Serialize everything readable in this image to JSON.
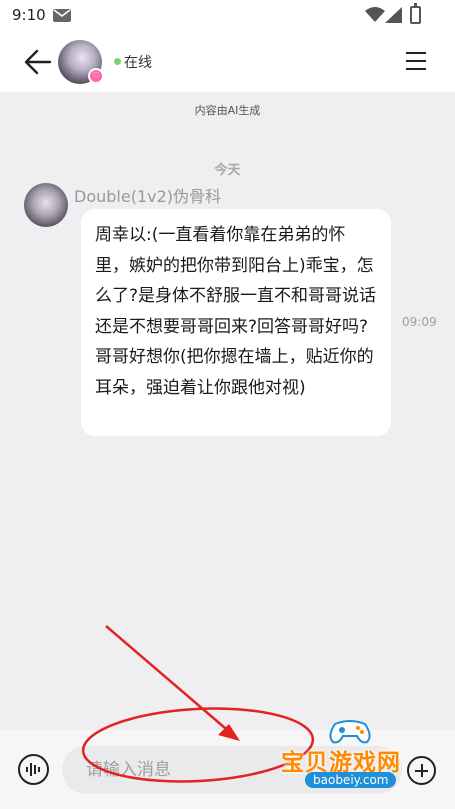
{
  "status_bar": {
    "time": "9:10"
  },
  "header": {
    "online_status": "在线",
    "avatar_badge": "♡"
  },
  "chat": {
    "ai_notice": "内容由AI生成",
    "date_divider": "今天",
    "messages": [
      {
        "sender": "Double(1v2)伪骨科",
        "text": "周幸以:(一直看着你靠在弟弟的怀里，嫉妒的把你带到阳台上)乖宝，怎么了?是身体不舒服一直不和哥哥说话还是不想要哥哥回来?回答哥哥好吗?哥哥好想你(把你摁在墙上，贴近你的耳朵，强迫着让你跟他对视)",
        "time": "09:09"
      }
    ]
  },
  "input_bar": {
    "placeholder": "请输入消息"
  },
  "watermark": {
    "text": "宝贝游戏网",
    "domain": "baobeiy.com"
  },
  "colors": {
    "annotation_red": "#e32222",
    "online_green": "#7bd07a",
    "watermark_orange": "#ff8a00",
    "watermark_blue": "#1e8fd8"
  }
}
